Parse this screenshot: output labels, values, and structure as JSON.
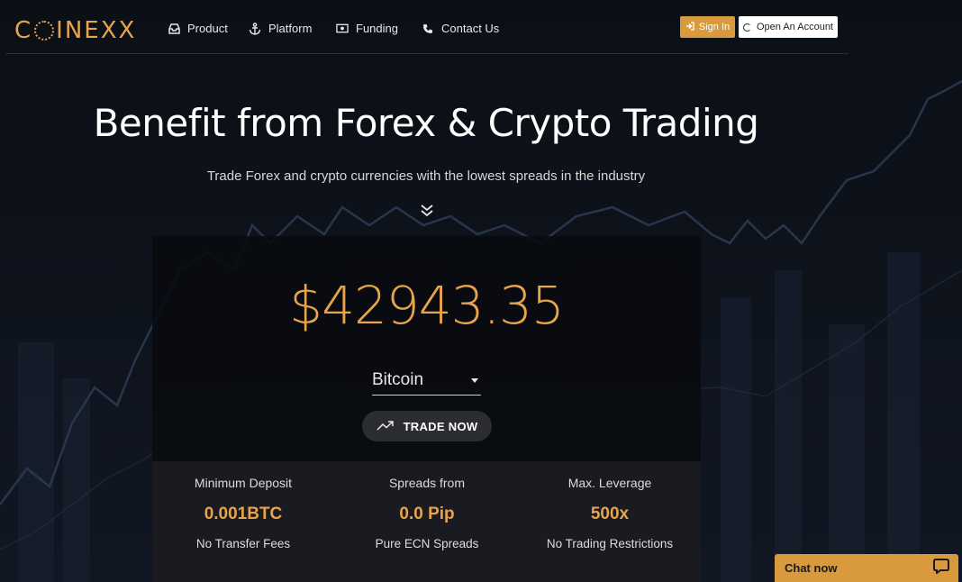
{
  "brand": {
    "logo_text_pre": "C",
    "logo_text_post": "INEXX"
  },
  "nav": [
    {
      "label": "Product",
      "icon": "inbox-icon"
    },
    {
      "label": "Platform",
      "icon": "anchor-icon"
    },
    {
      "label": "Funding",
      "icon": "money-icon"
    },
    {
      "label": "Contact Us",
      "icon": "phone-icon"
    }
  ],
  "auth": {
    "signin_label": "Sign In",
    "open_account_label": "Open An Account"
  },
  "hero": {
    "title": "Benefit from Forex & Crypto Trading",
    "subtitle": "Trade Forex and crypto currencies with the lowest spreads in the industry"
  },
  "ticker": {
    "price": "$42943.35",
    "asset": "Bitcoin",
    "trade_label": "TRADE NOW"
  },
  "stats": [
    {
      "label": "Minimum Deposit",
      "value": "0.001BTC",
      "sub": "No Transfer Fees"
    },
    {
      "label": "Spreads from",
      "value": "0.0 Pip",
      "sub": "Pure ECN Spreads"
    },
    {
      "label": "Max. Leverage",
      "value": "500x",
      "sub": "No Trading Restrictions"
    }
  ],
  "chat": {
    "label": "Chat now"
  },
  "colors": {
    "accent": "#e7a44b",
    "button_gold": "#d89a3d",
    "background": "#07090d"
  }
}
